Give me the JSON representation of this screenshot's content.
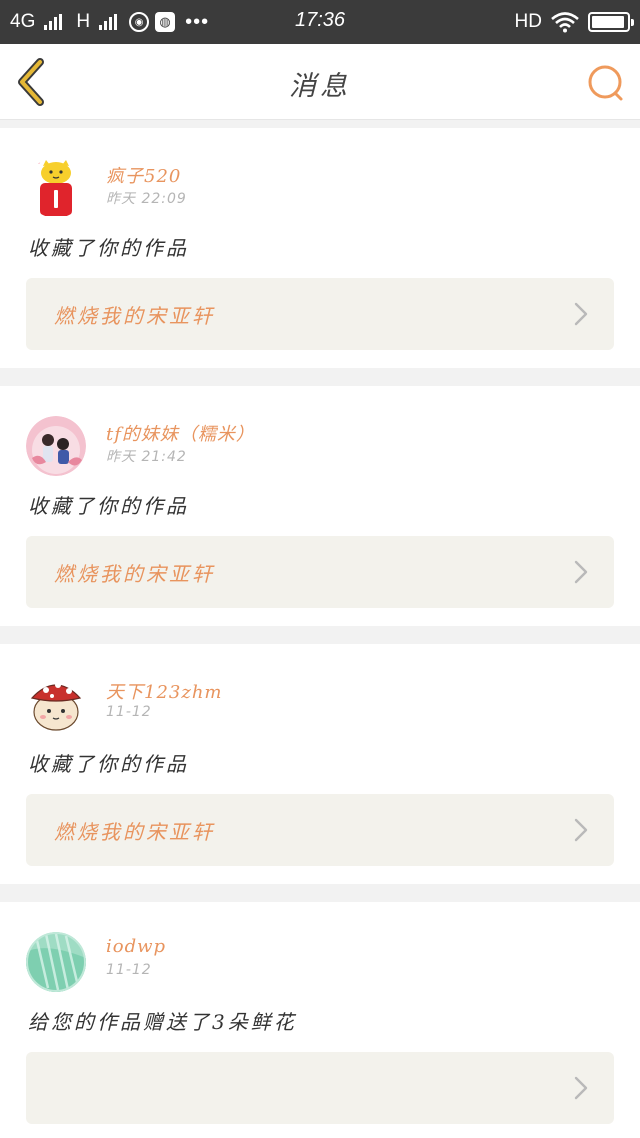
{
  "status_bar": {
    "network": "4G",
    "network2": "H",
    "dots": "•••",
    "time": "17:36",
    "hd": "HD",
    "icons": [
      "signal-icon",
      "location-icon",
      "browser-icon",
      "wifi-icon",
      "battery-icon"
    ],
    "battery_level": 0.95
  },
  "nav": {
    "title": "消息",
    "back_icon": "chevron-left-icon",
    "search_icon": "search-icon"
  },
  "colors": {
    "accent": "#e8945e",
    "status_bar_bg": "#3b3b3b",
    "card_bg": "#ffffff",
    "work_box_bg": "#f3f2ec",
    "separator": "#f2f2f2",
    "back_arrow": "#e5b836"
  },
  "messages": [
    {
      "username": "疯子520",
      "time": "昨天 22:09",
      "action": "收藏了你的作品",
      "work_title": "燃烧我的宋亚轩",
      "avatar_icon": "cat-avatar-icon"
    },
    {
      "username": "tf的妹妹（糯米）",
      "time": "昨天 21:42",
      "action": "收藏了你的作品",
      "work_title": "燃烧我的宋亚轩",
      "avatar_icon": "photo-avatar-icon"
    },
    {
      "username": "天下123zhm",
      "time": "11-12",
      "action": "收藏了你的作品",
      "work_title": "燃烧我的宋亚轩",
      "avatar_icon": "hamster-avatar-icon"
    },
    {
      "username": "iodwp",
      "time": "11-12",
      "action": "给您的作品赠送了3朵鲜花",
      "work_title": "",
      "avatar_icon": "green-avatar-icon"
    }
  ]
}
